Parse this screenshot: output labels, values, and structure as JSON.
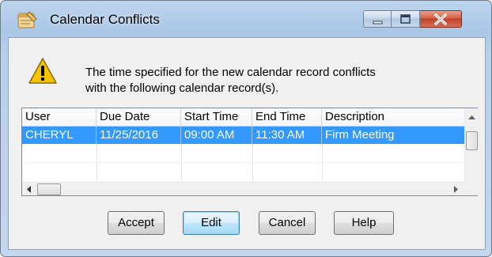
{
  "window": {
    "title": "Calendar Conflicts"
  },
  "message": {
    "line1": "The time specified for the new calendar record conflicts",
    "line2": "with the following calendar record(s)."
  },
  "list": {
    "columns": [
      "User",
      "Due Date",
      "Start Time",
      "End Time",
      "Description"
    ],
    "rows": [
      {
        "user": "CHERYL",
        "due_date": "11/25/2016",
        "start_time": "09:00 AM",
        "end_time": "11:30 AM",
        "description": "Firm Meeting",
        "selected": true
      }
    ]
  },
  "buttons": {
    "accept": "Accept",
    "edit": "Edit",
    "cancel": "Cancel",
    "help": "Help"
  },
  "icons": {
    "app": "calendar-notepad-icon",
    "warning": "warning-triangle-icon"
  },
  "colors": {
    "selection": "#3399ff",
    "close_button": "#c0412a",
    "warning": "#f5c400"
  }
}
